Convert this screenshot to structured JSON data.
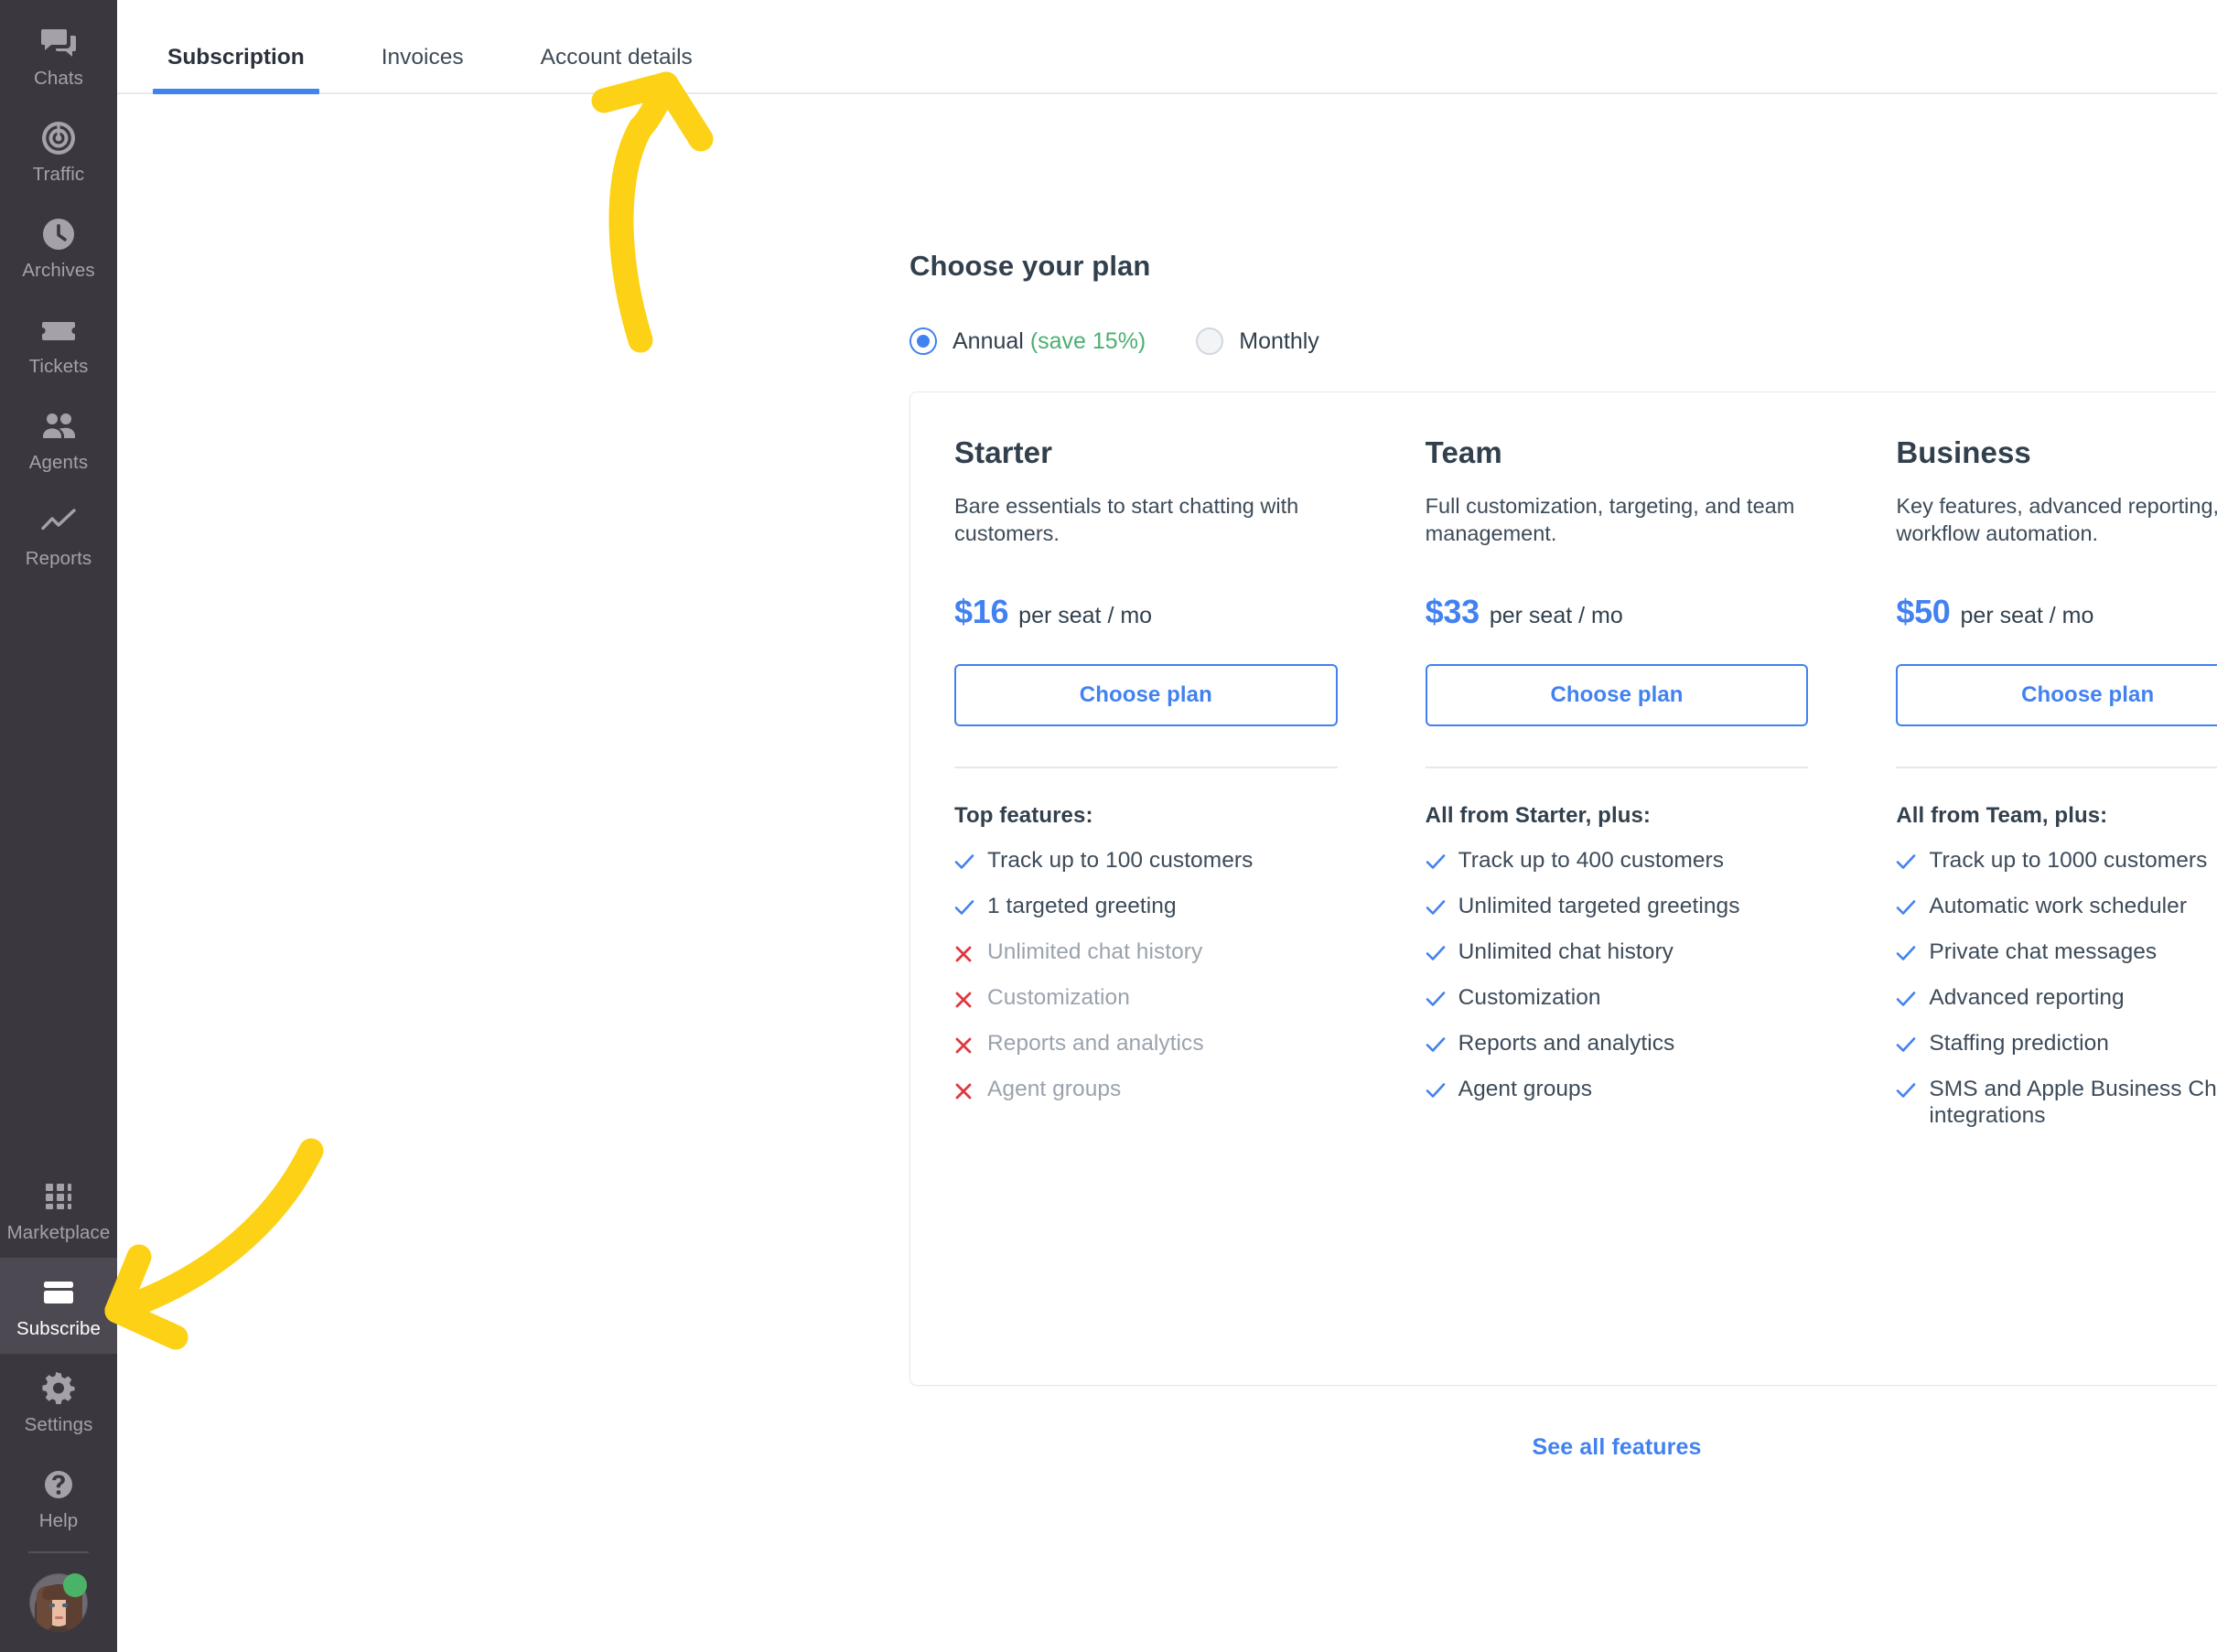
{
  "sidebar": {
    "top_items": [
      {
        "label": "Chats",
        "icon": "chats-icon",
        "active": false
      },
      {
        "label": "Traffic",
        "icon": "traffic-icon",
        "active": false
      },
      {
        "label": "Archives",
        "icon": "archives-clock-icon",
        "active": false
      },
      {
        "label": "Tickets",
        "icon": "tickets-icon",
        "active": false
      },
      {
        "label": "Agents",
        "icon": "agents-people-icon",
        "active": false
      },
      {
        "label": "Reports",
        "icon": "reports-chart-icon",
        "active": false
      }
    ],
    "bottom_items": [
      {
        "label": "Marketplace",
        "icon": "marketplace-grid-icon",
        "active": false
      },
      {
        "label": "Subscribe",
        "icon": "subscribe-card-icon",
        "active": true
      },
      {
        "label": "Settings",
        "icon": "settings-gear-icon",
        "active": false
      },
      {
        "label": "Help",
        "icon": "help-question-icon",
        "active": false
      }
    ],
    "avatar": {
      "name": "user-avatar",
      "status": "online"
    },
    "colors": {
      "background": "#3b373f",
      "active_background": "#4d4952",
      "label": "#a5a1a8",
      "active_label": "#ffffff",
      "status_online": "#4bb367"
    }
  },
  "tabs": [
    {
      "label": "Subscription",
      "active": true
    },
    {
      "label": "Invoices",
      "active": false
    },
    {
      "label": "Account details",
      "active": false
    }
  ],
  "main": {
    "title": "Choose your plan",
    "billing": {
      "options": [
        {
          "label": "Annual",
          "badge": "(save 15%)",
          "selected": true
        },
        {
          "label": "Monthly",
          "badge": "",
          "selected": false
        }
      ]
    },
    "plans": [
      {
        "name": "Starter",
        "description": "Bare essentials to start chatting with customers.",
        "price": "$16",
        "price_unit": "per seat / mo",
        "cta": "Choose plan",
        "features_title": "Top features:",
        "features": [
          {
            "text": "Track up to 100 customers",
            "included": true
          },
          {
            "text": "1 targeted greeting",
            "included": true
          },
          {
            "text": "Unlimited chat history",
            "included": false
          },
          {
            "text": "Customization",
            "included": false
          },
          {
            "text": "Reports and analytics",
            "included": false
          },
          {
            "text": "Agent groups",
            "included": false
          }
        ]
      },
      {
        "name": "Team",
        "description": "Full customization, targeting, and team management.",
        "price": "$33",
        "price_unit": "per seat / mo",
        "cta": "Choose plan",
        "features_title": "All from Starter, plus:",
        "features": [
          {
            "text": "Track up to 400 customers",
            "included": true
          },
          {
            "text": "Unlimited targeted greetings",
            "included": true
          },
          {
            "text": "Unlimited chat history",
            "included": true
          },
          {
            "text": "Customization",
            "included": true
          },
          {
            "text": "Reports and analytics",
            "included": true
          },
          {
            "text": "Agent groups",
            "included": true
          }
        ]
      },
      {
        "name": "Business",
        "description": "Key features, advanced reporting, and workflow automation.",
        "price": "$50",
        "price_unit": "per seat / mo",
        "cta": "Choose plan",
        "features_title": "All from Team, plus:",
        "features": [
          {
            "text": "Track up to 1000 customers",
            "included": true
          },
          {
            "text": "Automatic work scheduler",
            "included": true
          },
          {
            "text": "Private chat messages",
            "included": true
          },
          {
            "text": "Advanced reporting",
            "included": true
          },
          {
            "text": "Staffing prediction",
            "included": true
          },
          {
            "text": "SMS and Apple Business Chat integrations",
            "included": true
          }
        ]
      }
    ],
    "see_all_features": "See all features"
  },
  "annotations": {
    "color": "#fcd116",
    "arrows": [
      {
        "name": "arrow-to-account-details-tab",
        "points_to": "Account details"
      },
      {
        "name": "arrow-to-subscribe-sidebar-item",
        "points_to": "Subscribe"
      }
    ]
  },
  "colors": {
    "accent_blue": "#4282f0",
    "text_dark": "#32404d",
    "text_muted": "#9aa3ad",
    "check_blue": "#4282f0",
    "cross_red": "#e0383e",
    "save_green": "#4caf72",
    "annotation_yellow": "#fcd116"
  }
}
